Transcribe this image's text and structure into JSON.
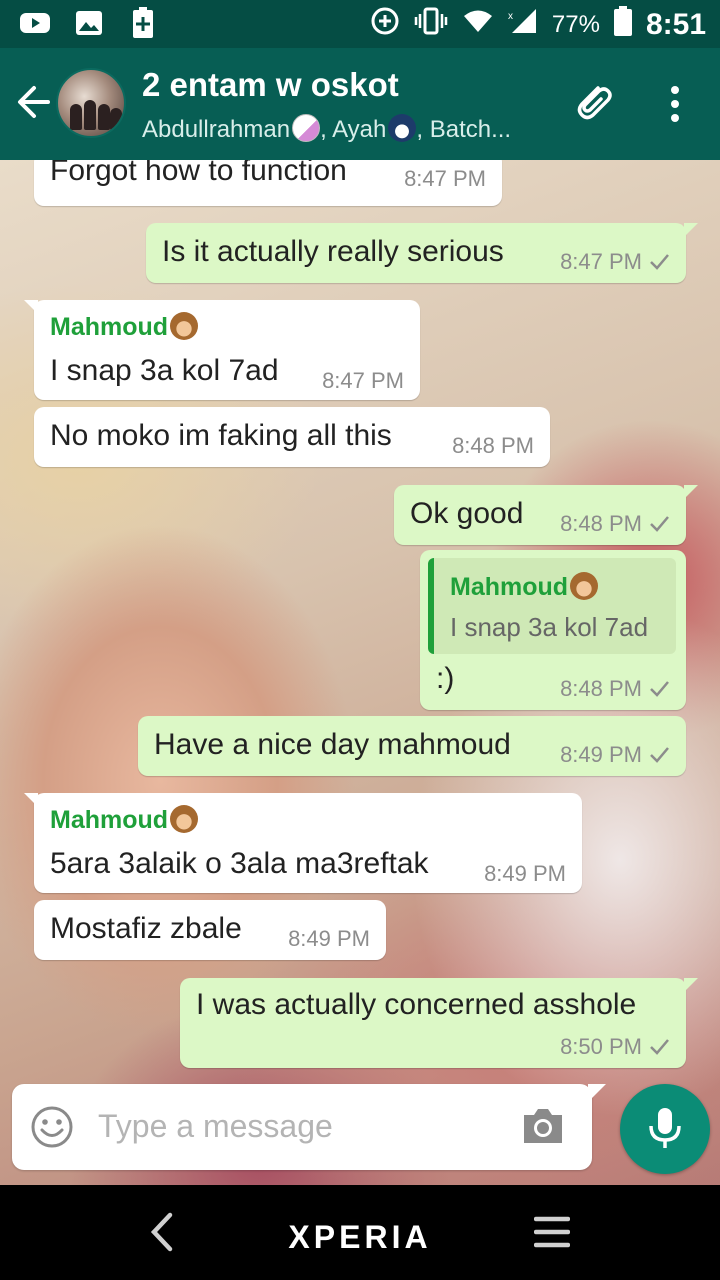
{
  "status_bar": {
    "battery": "77%",
    "time": "8:51",
    "icons": [
      "youtube-icon",
      "gallery-icon",
      "battery-saver-icon",
      "data-saver-icon",
      "vibrate-icon",
      "wifi-icon",
      "signal-icon",
      "battery-icon"
    ]
  },
  "header": {
    "title": "2 entam w oskot",
    "subtitle_parts": [
      "Abdullrahman",
      ", Ayah",
      ", Batch..."
    ],
    "icons": [
      "back-arrow-icon",
      "attachment-icon",
      "more-vert-icon"
    ]
  },
  "messages": [
    {
      "dir": "in",
      "text": "Forgot how to function",
      "time": "8:47 PM"
    },
    {
      "dir": "out",
      "text": "Is it actually really serious",
      "time": "8:47 PM"
    },
    {
      "dir": "in",
      "sender": "Mahmoud",
      "text": "I snap 3a kol 7ad",
      "time": "8:47 PM"
    },
    {
      "dir": "in",
      "text": "No moko im faking all this",
      "time": "8:48 PM"
    },
    {
      "dir": "out",
      "text": "Ok good",
      "time": "8:48 PM"
    },
    {
      "dir": "out",
      "quote": {
        "sender": "Mahmoud",
        "text": "I snap 3a kol 7ad"
      },
      "text": ":)",
      "time": "8:48 PM"
    },
    {
      "dir": "out",
      "text": "Have a nice day mahmoud",
      "time": "8:49 PM"
    },
    {
      "dir": "in",
      "sender": "Mahmoud",
      "text": "5ara 3alaik o 3ala ma3reftak",
      "time": "8:49 PM"
    },
    {
      "dir": "in",
      "text": "Mostafiz zbale",
      "time": "8:49 PM"
    },
    {
      "dir": "out",
      "text": "I was actually concerned asshole",
      "time": "8:50 PM"
    }
  ],
  "composer": {
    "placeholder": "Type a message"
  },
  "nav": {
    "brand": "XPERIA"
  },
  "colors": {
    "header": "#075e54",
    "status": "#054d44",
    "outgoing": "#dcf8c6",
    "incoming": "#ffffff",
    "sender": "#1fa03a",
    "mic": "#0b8c76"
  }
}
